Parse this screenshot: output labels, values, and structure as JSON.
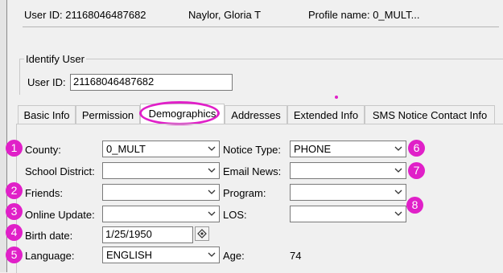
{
  "header": {
    "user_id_text": "User ID: 21168046487682",
    "user_name": "Naylor, Gloria T",
    "profile_name": "Profile name: 0_MULT..."
  },
  "identify": {
    "legend": "Identify User",
    "user_id_label": "User ID:",
    "user_id_value": "21168046487682"
  },
  "tabs": [
    {
      "label": "Basic Info"
    },
    {
      "label": "Permission"
    },
    {
      "label": "Demographics"
    },
    {
      "label": "Addresses"
    },
    {
      "label": "Extended Info"
    },
    {
      "label": "SMS Notice Contact Info"
    }
  ],
  "form": {
    "county_label": "County:",
    "county_value": "0_MULT",
    "school_district_label": "School District:",
    "school_district_value": "",
    "friends_label": "Friends:",
    "friends_value": "",
    "online_update_label": "Online Update:",
    "online_update_value": "",
    "birth_date_label": "Birth date:",
    "birth_date_value": "1/25/1950",
    "language_label": "Language:",
    "language_value": "ENGLISH",
    "notice_type_label": "Notice Type:",
    "notice_type_value": "PHONE",
    "email_news_label": "Email News:",
    "email_news_value": "",
    "program_label": "Program:",
    "program_value": "",
    "los_label": "LOS:",
    "los_value": "",
    "age_label": "Age:",
    "age_value": "74"
  },
  "badges": [
    "1",
    "2",
    "3",
    "4",
    "5",
    "6",
    "7",
    "8"
  ],
  "colors": {
    "annotation": "#e020c8"
  }
}
